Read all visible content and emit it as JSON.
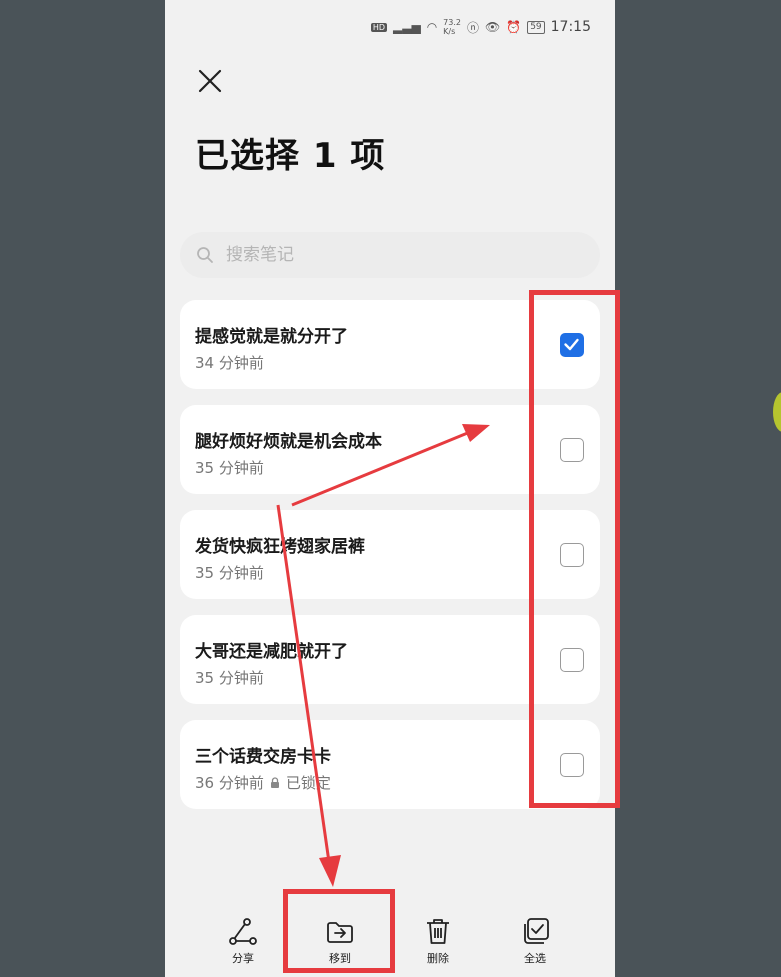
{
  "status_bar": {
    "time": "17:15",
    "network_speed": "73.2",
    "network_unit": "K/s",
    "battery": "59"
  },
  "header": {
    "title": "已选择 1 项"
  },
  "search": {
    "placeholder": "搜索笔记"
  },
  "notes": [
    {
      "title": "提感觉就是就分开了",
      "meta": "34 分钟前",
      "checked": true
    },
    {
      "title": "腿好烦好烦就是机会成本",
      "meta": "35 分钟前",
      "checked": false
    },
    {
      "title": "发货快疯狂烤翅家居裤",
      "meta": "35 分钟前",
      "checked": false
    },
    {
      "title": "大哥还是减肥就开了",
      "meta": "35 分钟前",
      "checked": false
    },
    {
      "title": "三个话费交房卡卡",
      "meta": "36 分钟前",
      "locked_label": "已锁定",
      "checked": false
    }
  ],
  "toolbar": {
    "share": "分享",
    "move": "移到",
    "delete": "删除",
    "select_all": "全选"
  },
  "colors": {
    "accent": "#1f6fe5",
    "annotation": "#e63b3f",
    "background": "#4a5358"
  },
  "icons": {
    "close": "close-icon",
    "search": "search-icon",
    "lock": "lock-icon",
    "share": "share-icon",
    "move": "move-folder-icon",
    "delete": "trash-icon",
    "select_all": "select-all-icon"
  }
}
